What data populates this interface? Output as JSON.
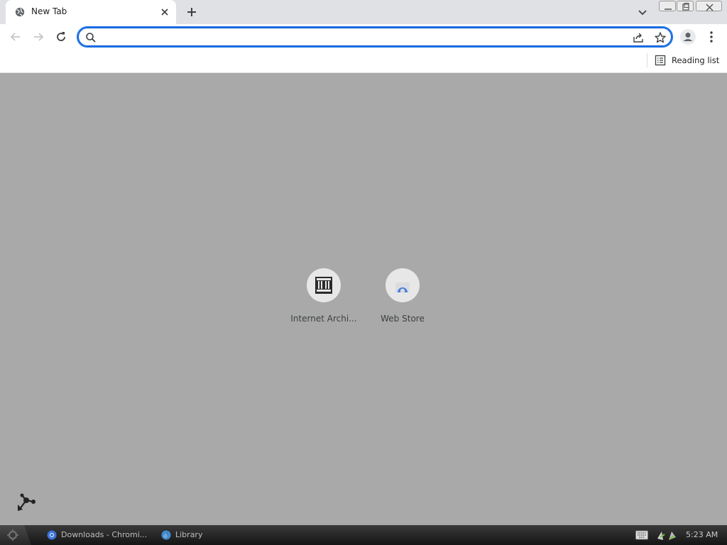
{
  "browser": {
    "tab": {
      "title": "New Tab",
      "icon": "globe-icon"
    },
    "new_tab_icon": "plus-icon",
    "window_controls": [
      "minimize",
      "maximize",
      "close"
    ]
  },
  "toolbar": {
    "omnibox": {
      "value": "",
      "placeholder": ""
    },
    "accent_color": "#1a73e8"
  },
  "bookmarks_bar": {
    "reading_list_label": "Reading list"
  },
  "shortcuts": [
    {
      "label": "Internet Archi...",
      "icon": "internet-archive-icon"
    },
    {
      "label": "Web Store",
      "icon": "web-store-icon"
    }
  ],
  "content": {
    "background": "#a9a9a9"
  },
  "taskbar": {
    "items": [
      {
        "label": "Downloads - Chromi...",
        "icon": "chromium-icon"
      },
      {
        "label": "Library",
        "icon": "firefox-icon"
      }
    ],
    "clock": "5:23 AM"
  }
}
